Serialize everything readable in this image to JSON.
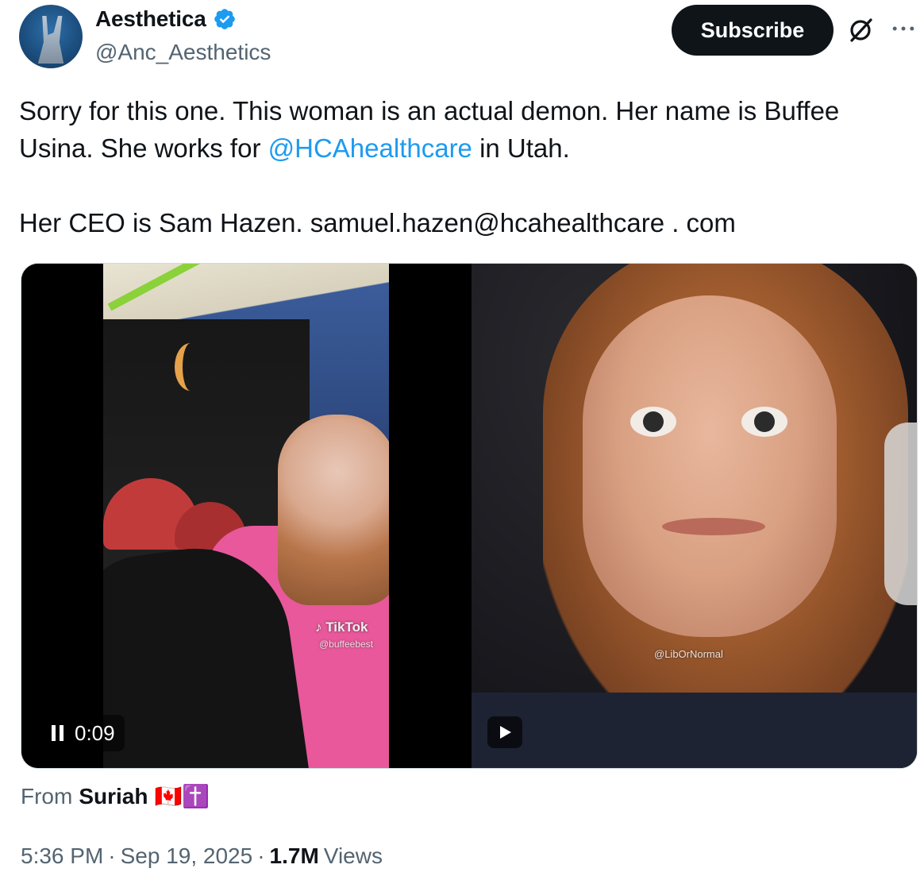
{
  "author": {
    "display_name": "Aesthetica",
    "handle": "@Anc_Aesthetics",
    "verified": true
  },
  "actions": {
    "subscribe_label": "Subscribe",
    "grok_icon": "grok-icon",
    "more_icon": "more-icon"
  },
  "tweet": {
    "line1": "Sorry for this one. This woman is an actual demon. Her name is Buffee",
    "line2_prefix": "Usina. She works for ",
    "line2_mention": "@HCAhealthcare",
    "line2_suffix": " in Utah.",
    "line3": "Her CEO is Sam Hazen. samuel.hazen@hcahealthcare . com"
  },
  "media": {
    "left_video": {
      "tiktok_logo": "TikTok",
      "tiktok_user": "@buffeebest",
      "timestamp": "0:09",
      "state": "playing"
    },
    "right_video": {
      "watermark": "@LibOrNormal",
      "state": "paused"
    }
  },
  "source": {
    "prefix": "From",
    "name": "Suriah",
    "emoji": "🇨🇦✝️"
  },
  "meta": {
    "time": "5:36 PM",
    "sep1": "·",
    "date": "Sep 19, 2025",
    "sep2": "·",
    "views_count": "1.7M",
    "views_label": "Views"
  },
  "colors": {
    "link": "#1d9bf0",
    "text": "#0f1419",
    "muted": "#536471",
    "verified": "#1d9bf0"
  }
}
